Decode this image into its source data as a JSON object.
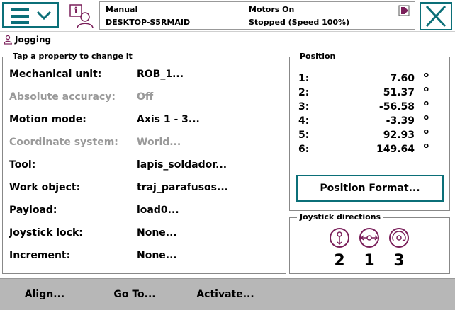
{
  "header": {
    "menu_icon": "hamburger-menu-icon",
    "status": {
      "mode": "Manual",
      "controller": "DESKTOP-S5RMAID",
      "motors": "Motors On",
      "state": "Stopped (Speed 100%)"
    },
    "close_icon": "close-icon"
  },
  "subheader": {
    "title": "Jogging"
  },
  "properties": {
    "title": "Tap a property to change it",
    "rows": [
      {
        "label": "Mechanical unit:",
        "value": "ROB_1..."
      },
      {
        "label": "Absolute accuracy:",
        "value": "Off"
      },
      {
        "label": "Motion mode:",
        "value": "Axis 1 - 3..."
      },
      {
        "label": "Coordinate system:",
        "value": "World..."
      },
      {
        "label": "Tool:",
        "value": "lapis_soldador..."
      },
      {
        "label": "Work object:",
        "value": "traj_parafusos..."
      },
      {
        "label": "Payload:",
        "value": "load0..."
      },
      {
        "label": "Joystick lock:",
        "value": "None..."
      },
      {
        "label": "Increment:",
        "value": "None..."
      }
    ]
  },
  "position": {
    "title": "Position",
    "rows": [
      {
        "index": "1:",
        "value": "7.60",
        "unit": "o"
      },
      {
        "index": "2:",
        "value": "51.37",
        "unit": "o"
      },
      {
        "index": "3:",
        "value": "-56.58",
        "unit": "o"
      },
      {
        "index": "4:",
        "value": "-3.39",
        "unit": "o"
      },
      {
        "index": "5:",
        "value": "92.93",
        "unit": "o"
      },
      {
        "index": "6:",
        "value": "149.64",
        "unit": "o"
      }
    ],
    "format_button": "Position Format..."
  },
  "joystick": {
    "title": "Joystick directions",
    "directions": [
      "2",
      "1",
      "3"
    ]
  },
  "toolbar": {
    "align": "Align...",
    "goto": "Go To...",
    "activate": "Activate..."
  },
  "colors": {
    "accent": "#0b6f78",
    "icon_purple": "#7a1f5a",
    "bottom_bar": "#b7b7b7"
  }
}
